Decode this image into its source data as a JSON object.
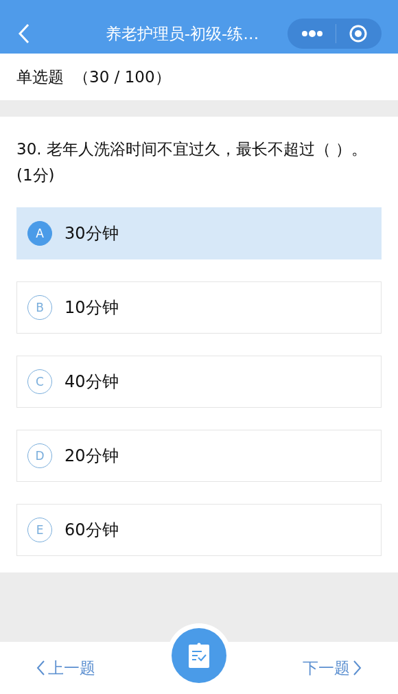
{
  "nav": {
    "title": "养老护理员-初级-练…"
  },
  "header": {
    "type": "单选题",
    "progress": "（30 / 100）"
  },
  "question": {
    "text": "30. 老年人洗浴时间不宜过久，最长不超过（ ）。(1分)"
  },
  "options": [
    {
      "letter": "A",
      "text": "30分钟",
      "selected": true
    },
    {
      "letter": "B",
      "text": "10分钟",
      "selected": false
    },
    {
      "letter": "C",
      "text": "40分钟",
      "selected": false
    },
    {
      "letter": "D",
      "text": "20分钟",
      "selected": false
    },
    {
      "letter": "E",
      "text": "60分钟",
      "selected": false
    }
  ],
  "footer": {
    "prev": "上一题",
    "next": "下一题"
  }
}
